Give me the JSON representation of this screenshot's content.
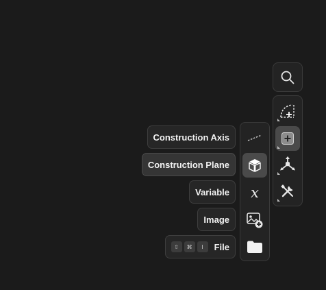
{
  "search": {
    "icon": "search-icon"
  },
  "right_toolbar": {
    "items": [
      {
        "icon": "sketch-arc-icon",
        "active": false
      },
      {
        "icon": "insert-plus-icon",
        "active": true
      },
      {
        "icon": "transform-axes-icon",
        "active": false
      },
      {
        "icon": "tools-wrench-icon",
        "active": false
      }
    ]
  },
  "insert_menu": {
    "items": [
      {
        "label": "Construction Axis",
        "icon": "construction-axis-icon",
        "active": false
      },
      {
        "label": "Construction Plane",
        "icon": "construction-plane-icon",
        "active": true
      },
      {
        "label": "Variable",
        "icon": "variable-icon",
        "glyph": "x",
        "active": false
      },
      {
        "label": "Image",
        "icon": "image-add-icon",
        "active": false
      },
      {
        "label": "File",
        "icon": "folder-icon",
        "active": false,
        "shortcut": [
          "⇧",
          "⌘",
          "I"
        ]
      }
    ]
  },
  "colors": {
    "background": "#1b1b1b",
    "panel": "#232323",
    "active": "#4a4a4a",
    "text": "#f2f2f2"
  }
}
